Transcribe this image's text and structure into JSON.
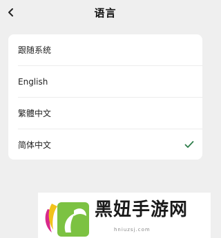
{
  "header": {
    "back_icon": "chevron-left-icon",
    "title": "语言"
  },
  "languages": [
    {
      "label": "跟随系统",
      "selected": false
    },
    {
      "label": "English",
      "selected": false
    },
    {
      "label": "繁體中文",
      "selected": false
    },
    {
      "label": "简体中文",
      "selected": true
    }
  ],
  "colors": {
    "accent": "#2e7d4a",
    "background": "#efefef",
    "card": "#ffffff"
  },
  "watermark": {
    "text": "黑妞手游网",
    "sub": "hniuzsj.com"
  }
}
